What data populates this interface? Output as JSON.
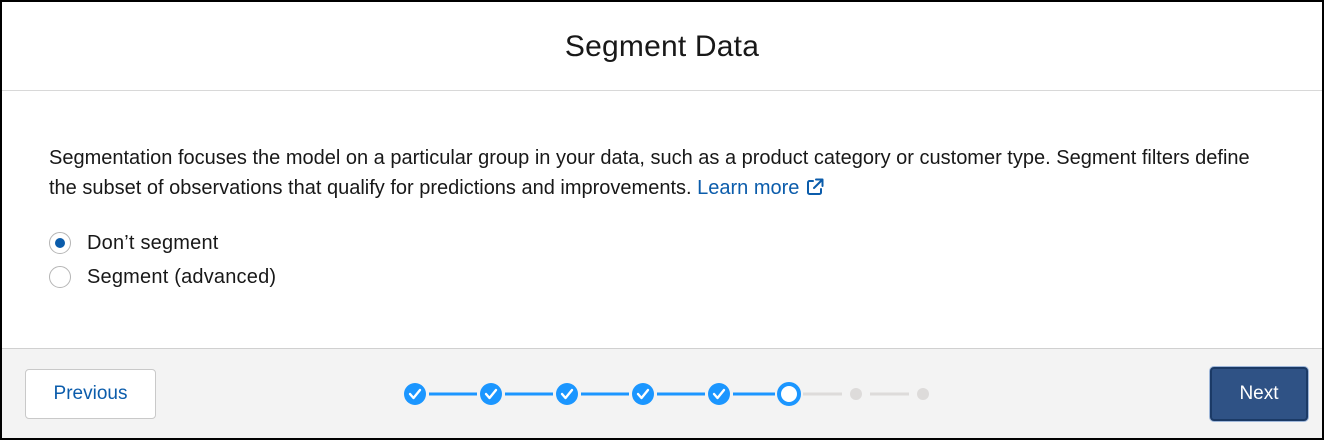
{
  "modal": {
    "title": "Segment Data",
    "description": "Segmentation focuses the model on a particular group in your data, such as a product category or customer type. Segment filters define the subset of observations that qualify for predictions and improvements.",
    "learn_more_label": "Learn more",
    "learn_more_icon": "external-link-icon"
  },
  "segment_options": [
    {
      "label": "Don’t segment",
      "selected": true
    },
    {
      "label": "Segment (advanced)",
      "selected": false
    }
  ],
  "footer": {
    "previous_label": "Previous",
    "next_label": "Next"
  },
  "progress": {
    "total_steps": 8,
    "current_step": 6,
    "completed_steps": 5
  },
  "colors": {
    "accent": "#0b5cab",
    "progress_complete": "#1b96ff",
    "progress_incomplete": "#dddbda",
    "next_button": "#2f5285"
  }
}
